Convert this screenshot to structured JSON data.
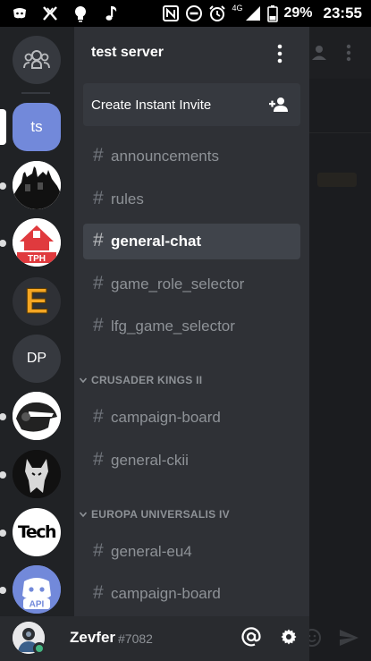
{
  "status_bar": {
    "network": "4G",
    "battery": "29%",
    "time": "23:55"
  },
  "rail": {
    "servers": [
      {
        "name": "ts",
        "label": "ts"
      },
      {
        "name": "DP",
        "label": "DP"
      },
      {
        "name": "Tech",
        "label": "Tech"
      },
      {
        "name": "API",
        "label": "API"
      },
      {
        "name": "TPH",
        "label": "TPH"
      },
      {
        "name": "E",
        "label": "E"
      }
    ]
  },
  "server": {
    "title": "test server",
    "invite_label": "Create Instant Invite"
  },
  "channels": {
    "hash": "#",
    "top": [
      {
        "name": "announcements"
      },
      {
        "name": "rules"
      },
      {
        "name": "general-chat",
        "selected": true
      },
      {
        "name": "game_role_selector"
      },
      {
        "name": "lfg_game_selector"
      }
    ],
    "categories": [
      {
        "name": "CRUSADER KINGS II",
        "channels": [
          {
            "name": "campaign-board"
          },
          {
            "name": "general-ckii"
          }
        ]
      },
      {
        "name": "EUROPA UNIVERSALIS IV",
        "channels": [
          {
            "name": "general-eu4"
          },
          {
            "name": "campaign-board"
          }
        ]
      }
    ]
  },
  "user": {
    "name": "Zevfer",
    "discriminator": "#7082",
    "status": "online"
  },
  "colors": {
    "blurple": "#7289da",
    "online": "#43b581",
    "rail_bg": "#202225",
    "panel_bg": "#2f3136",
    "selected_bg": "#40444b"
  }
}
